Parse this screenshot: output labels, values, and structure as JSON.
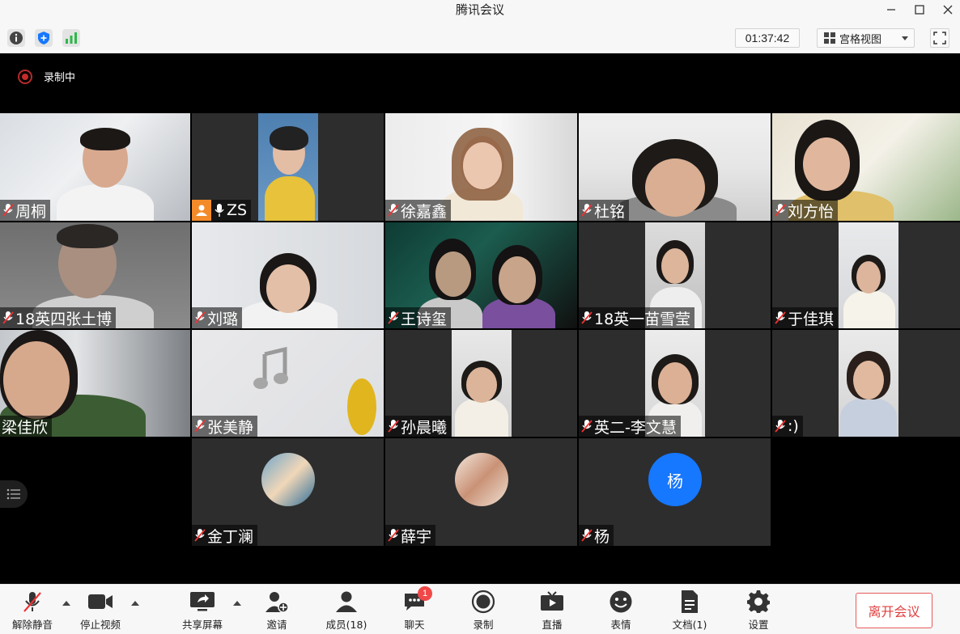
{
  "window": {
    "title": "腾讯会议"
  },
  "toolbar": {
    "timer": "01:37:42",
    "view_mode": "宫格视图"
  },
  "recording": {
    "label": "录制中"
  },
  "participants": [
    {
      "name": "周桐"
    },
    {
      "name": "ZS"
    },
    {
      "name": "徐嘉鑫"
    },
    {
      "name": "杜铭"
    },
    {
      "name": "刘方怡"
    },
    {
      "name": "18英四张土博"
    },
    {
      "name": "刘璐"
    },
    {
      "name": "王诗玺"
    },
    {
      "name": "18英一苗雪莹"
    },
    {
      "name": "于佳琪"
    },
    {
      "name": "梁佳欣"
    },
    {
      "name": "张美静"
    },
    {
      "name": "孙晨曦"
    },
    {
      "name": "英二-李文慧"
    },
    {
      "name": ":)"
    },
    {
      "name": "金丁澜"
    },
    {
      "name": "薛宇"
    },
    {
      "name": "杨",
      "avatar_letter": "杨"
    }
  ],
  "bottom_bar": {
    "unmute": "解除静音",
    "stop_video": "停止视频",
    "share_screen": "共享屏幕",
    "invite": "邀请",
    "members": "成员(18)",
    "chat": "聊天",
    "chat_badge": "1",
    "record": "录制",
    "live": "直播",
    "emoji": "表情",
    "docs": "文档(1)",
    "settings": "设置",
    "leave": "离开会议"
  },
  "colors": {
    "accent_blue": "#1677ff",
    "leave_red": "#e04040",
    "share_orange": "#f48b2a",
    "recording_red": "#c62a2a"
  }
}
